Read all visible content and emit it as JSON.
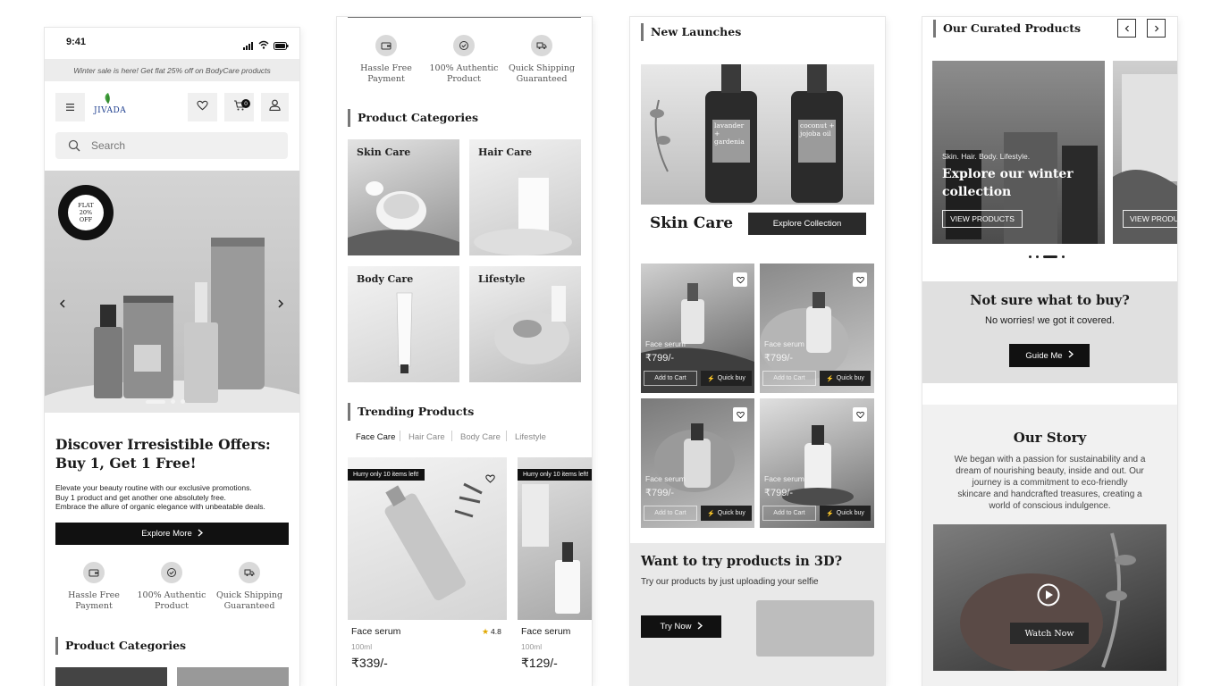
{
  "panel1": {
    "status_time": "9:41",
    "promo_banner": "Winter sale is here! Get flat 25% off on BodyCare products",
    "logo_text": "JIVADA",
    "cart_count": "0",
    "search_placeholder": "Search",
    "badge_text": "FLAT 20% OFF",
    "offer_title_line1": "Discover Irresistible Offers:",
    "offer_title_line2": "Buy 1, Get 1 Free!",
    "offer_desc_line1": "Elevate your beauty routine with our exclusive promotions.",
    "offer_desc_line2": "Buy 1 product and get another one absolutely free.",
    "offer_desc_line3": "Embrace the allure of organic elegance with unbeatable deals.",
    "explore_more": "Explore More",
    "features": [
      {
        "line1": "Hassle Free",
        "line2": "Payment",
        "icon": "wallet-icon"
      },
      {
        "line1": "100% Authentic",
        "line2": "Product",
        "icon": "check-badge-icon"
      },
      {
        "line1": "Quick Shipping",
        "line2": "Guaranteed",
        "icon": "truck-icon"
      }
    ],
    "categories_title": "Product Categories"
  },
  "panel2": {
    "features": [
      {
        "line1": "Hassle Free",
        "line2": "Payment",
        "icon": "wallet-icon"
      },
      {
        "line1": "100% Authentic",
        "line2": "Product",
        "icon": "check-badge-icon"
      },
      {
        "line1": "Quick Shipping",
        "line2": "Guaranteed",
        "icon": "truck-icon"
      }
    ],
    "categories_title": "Product Categories",
    "categories": [
      "Skin Care",
      "Hair Care",
      "Body Care",
      "Lifestyle"
    ],
    "trending_title": "Trending Products",
    "tabs": [
      "Face Care",
      "Hair Care",
      "Body Care",
      "Lifestyle"
    ],
    "products": [
      {
        "tag": "Hurry only 10 items left!",
        "name": "Face serum",
        "rating": "4.8",
        "size": "100ml",
        "price": "₹339/-"
      },
      {
        "tag": "Hurry only 10 items left!",
        "name": "Face serum",
        "size": "100ml",
        "price": "₹129/-"
      }
    ]
  },
  "panel3": {
    "launches_title": "New Launches",
    "bottle1_label": "lavander + gardenia",
    "bottle2_label": "coconut + jojoba oil",
    "skin_care_title": "Skin Care",
    "explore_collection": "Explore Collection",
    "cards": [
      {
        "name": "Face serum",
        "price": "₹799/-",
        "add": "Add to Cart",
        "quick": "Quick buy"
      },
      {
        "name": "Face serum",
        "price": "₹799/-",
        "add": "Add to Cart",
        "quick": "Quick buy"
      },
      {
        "name": "Face serum",
        "price": "₹799/-",
        "add": "Add to Cart",
        "quick": "Quick buy"
      },
      {
        "name": "Face serum",
        "price": "₹799/-",
        "add": "Add to Cart",
        "quick": "Quick buy"
      }
    ],
    "try3d_title": "Want to try products in 3D?",
    "try3d_desc": "Try our products by just uploading your selfie",
    "try_now": "Try Now"
  },
  "panel4": {
    "curated_title": "Our Curated Products",
    "slide_tagline": "Skin. Hair. Body. Lifestyle.",
    "slide_title_line1": "Explore our winter",
    "slide_title_line2": "collection",
    "view_products": "VIEW PRODUCTS",
    "view_products_2": "VIEW PRODU",
    "not_sure_title": "Not sure what to buy?",
    "not_sure_desc": "No worries! we got it covered.",
    "guide_me": "Guide Me",
    "story_title": "Our Story",
    "story_line1": "We began with a passion for sustainability and a",
    "story_line2": "dream of nourishing beauty, inside and out. Our",
    "story_line3": "journey is a commitment to eco-friendly",
    "story_line4": "skincare and handcrafted treasures, creating a",
    "story_line5": "world of conscious indulgence.",
    "watch_now": "Watch Now"
  }
}
